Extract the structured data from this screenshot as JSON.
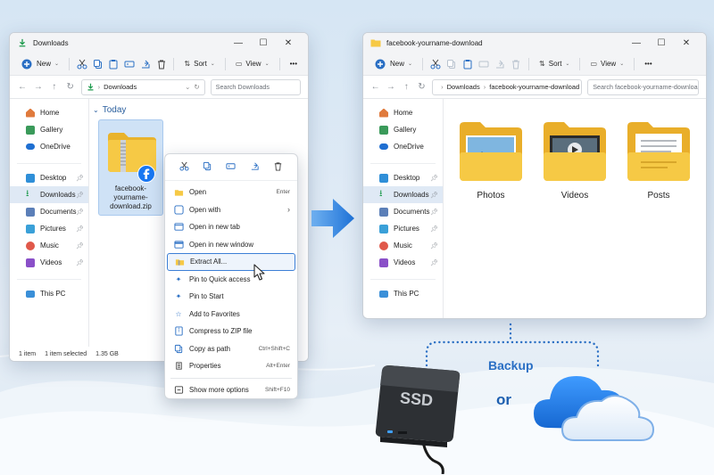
{
  "left_window": {
    "title": "Downloads",
    "toolbar": {
      "new_label": "New",
      "sort_label": "Sort",
      "view_label": "View",
      "more_label": "•••"
    },
    "address": {
      "path_segment": "Downloads"
    },
    "search": {
      "placeholder": "Search Downloads"
    },
    "sidebar": {
      "items": [
        {
          "label": "Home"
        },
        {
          "label": "Gallery"
        },
        {
          "label": "OneDrive"
        },
        {
          "label": "Desktop"
        },
        {
          "label": "Downloads"
        },
        {
          "label": "Documents"
        },
        {
          "label": "Pictures"
        },
        {
          "label": "Music"
        },
        {
          "label": "Videos"
        },
        {
          "label": "This PC"
        }
      ]
    },
    "section_header": "Today",
    "file": {
      "name_line1": "facebook-",
      "name_line2": "yourname-",
      "name_line3": "download.zip"
    },
    "status": {
      "count": "1 item",
      "selected": "1 item selected",
      "size": "1.35 GB"
    }
  },
  "context_menu": {
    "items": [
      {
        "label": "Open",
        "shortcut": "Enter"
      },
      {
        "label": "Open with",
        "shortcut": "›"
      },
      {
        "label": "Open in new tab",
        "shortcut": ""
      },
      {
        "label": "Open in new window",
        "shortcut": ""
      },
      {
        "label": "Extract All...",
        "shortcut": ""
      },
      {
        "label": "Pin to Quick access",
        "shortcut": ""
      },
      {
        "label": "Pin to Start",
        "shortcut": ""
      },
      {
        "label": "Add to Favorites",
        "shortcut": ""
      },
      {
        "label": "Compress to ZIP file",
        "shortcut": ""
      },
      {
        "label": "Copy as path",
        "shortcut": "Ctrl+Shift+C"
      },
      {
        "label": "Properties",
        "shortcut": "Alt+Enter"
      },
      {
        "label": "Show more options",
        "shortcut": "Shift+F10"
      }
    ]
  },
  "right_window": {
    "title": "facebook-yourname-download",
    "toolbar": {
      "new_label": "New",
      "sort_label": "Sort",
      "view_label": "View",
      "more_label": "•••"
    },
    "address": {
      "segment1": "Downloads",
      "segment2": "facebook-yourname-download"
    },
    "search": {
      "placeholder": "Search facebook-yourname-download"
    },
    "sidebar": {
      "items": [
        {
          "label": "Home"
        },
        {
          "label": "Gallery"
        },
        {
          "label": "OneDrive"
        },
        {
          "label": "Desktop"
        },
        {
          "label": "Downloads"
        },
        {
          "label": "Documents"
        },
        {
          "label": "Pictures"
        },
        {
          "label": "Music"
        },
        {
          "label": "Videos"
        },
        {
          "label": "This PC"
        }
      ]
    },
    "folders": [
      {
        "label": "Photos"
      },
      {
        "label": "Videos"
      },
      {
        "label": "Posts"
      }
    ]
  },
  "backup": {
    "backup_label": "Backup",
    "or_label": "or",
    "ssd_label": "SSD"
  },
  "colors": {
    "accent": "#2a6fc4",
    "folder": "#f6c945",
    "facebook": "#1877f2"
  }
}
